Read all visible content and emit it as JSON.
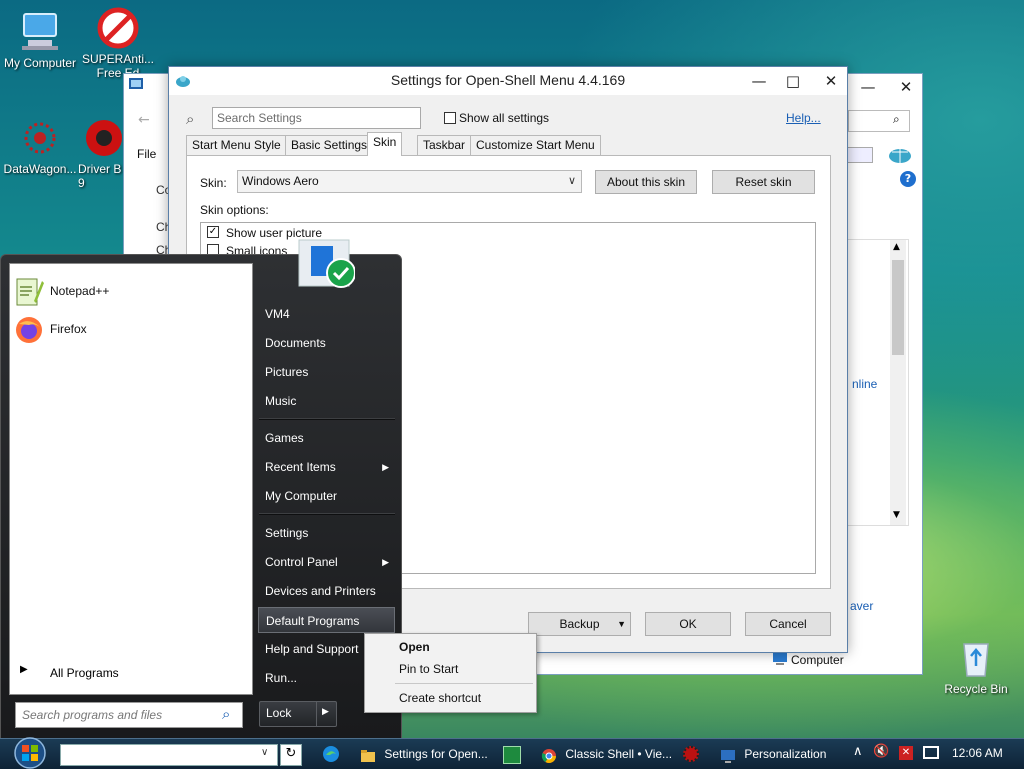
{
  "desktop": {
    "icons": [
      {
        "label": "My Computer",
        "icon": "computer-icon"
      },
      {
        "label": "SUPERAnti... Free Ed",
        "icon": "superantispyware-icon"
      },
      {
        "label": "DataWagon...",
        "icon": "datawagon-icon"
      },
      {
        "label": "Driver B 9",
        "icon": "driver-booster-icon"
      },
      {
        "label": "Recycle Bin",
        "icon": "recycle-bin-icon"
      }
    ]
  },
  "bg_window": {
    "menu_file": "File",
    "side_labels": [
      "Co",
      "Ch",
      "Ch"
    ],
    "link_online": "nline",
    "link_saver": "aver",
    "computer_label": "Computer"
  },
  "dialog": {
    "title": "Settings for Open-Shell Menu 4.4.169",
    "search_placeholder": "Search Settings",
    "show_all_label": "Show all settings",
    "help_link": "Help...",
    "tabs": [
      "Start Menu Style",
      "Basic Settings",
      "Skin",
      "Taskbar",
      "Customize Start Menu"
    ],
    "active_tab": "Skin",
    "skin_label": "Skin:",
    "skin_value": "Windows Aero",
    "about_skin": "About this skin",
    "reset_skin": "Reset skin",
    "skin_options_label": "Skin options:",
    "options": [
      {
        "label": "Show user picture",
        "checked": true
      },
      {
        "label": "Small icons",
        "checked": false
      }
    ],
    "backup": "Backup",
    "ok": "OK",
    "cancel": "Cancel"
  },
  "start_menu": {
    "pinned": [
      {
        "label": "Notepad++",
        "icon": "notepadpp-icon"
      },
      {
        "label": "Firefox",
        "icon": "firefox-icon"
      }
    ],
    "all_programs": "All Programs",
    "search_placeholder": "Search programs and files",
    "right_items": [
      {
        "label": "VM4",
        "arrow": false
      },
      {
        "label": "Documents",
        "arrow": false
      },
      {
        "label": "Pictures",
        "arrow": false
      },
      {
        "label": "Music",
        "arrow": false
      },
      {
        "label": "Games",
        "arrow": false
      },
      {
        "label": "Recent Items",
        "arrow": true
      },
      {
        "label": "My Computer",
        "arrow": false
      },
      {
        "label": "Settings",
        "arrow": false
      },
      {
        "label": "Control Panel",
        "arrow": true
      },
      {
        "label": "Devices and Printers",
        "arrow": false
      },
      {
        "label": "Default Programs",
        "arrow": false
      },
      {
        "label": "Help and Support",
        "arrow": false
      },
      {
        "label": "Run...",
        "arrow": false
      }
    ],
    "highlighted": "Default Programs",
    "lock": "Lock"
  },
  "context_menu": {
    "items": [
      "Open",
      "Pin to Start",
      "Create shortcut"
    ]
  },
  "taskbar": {
    "tasks": [
      {
        "label": "Settings for Open...",
        "icon": "settings-folder-icon"
      },
      {
        "label": "Classic Shell • Vie...",
        "icon": "chrome-icon"
      },
      {
        "label": "Personalization",
        "icon": "personalization-icon"
      }
    ],
    "clock": "12:06 AM"
  },
  "colors": {
    "accent": "#0078d7",
    "start_menu_bg": "#1f2022",
    "taskbar_bg": "#132c42"
  }
}
